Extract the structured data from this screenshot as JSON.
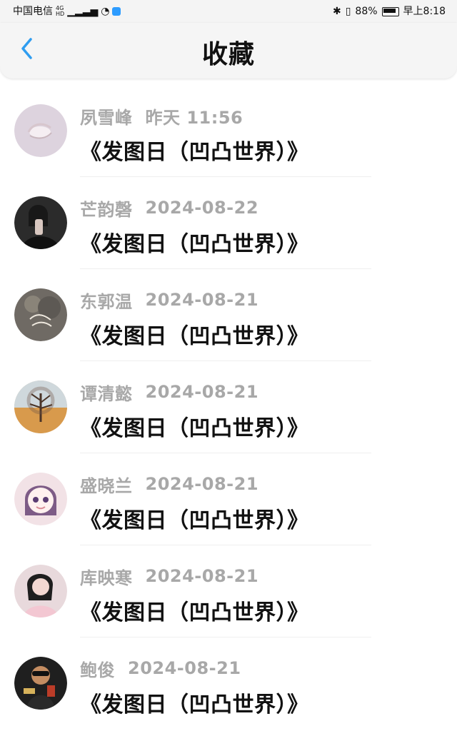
{
  "status_bar": {
    "carrier": "中国电信",
    "network_1": "4G",
    "network_2": "HD",
    "battery": "88%",
    "time": "早上8:18"
  },
  "header": {
    "title": "收藏"
  },
  "favorites": [
    {
      "name": "夙雪峰",
      "time": "昨天 11:56",
      "title": "《发图日（凹凸世界）》",
      "avatar": "avatar-seashell"
    },
    {
      "name": "芒韵磬",
      "time": "2024-08-22",
      "title": "《发图日（凹凸世界）》",
      "avatar": "avatar-selfie"
    },
    {
      "name": "东郭温",
      "time": "2024-08-21",
      "title": "《发图日（凹凸世界）》",
      "avatar": "avatar-hello-august"
    },
    {
      "name": "谭清懿",
      "time": "2024-08-21",
      "title": "《发图日（凹凸世界）》",
      "avatar": "avatar-tree"
    },
    {
      "name": "盛晓兰",
      "time": "2024-08-21",
      "title": "《发图日（凹凸世界）》",
      "avatar": "avatar-anime-girl"
    },
    {
      "name": "库映寒",
      "time": "2024-08-21",
      "title": "《发图日（凹凸世界）》",
      "avatar": "avatar-portrait"
    },
    {
      "name": "鲍俊",
      "time": "2024-08-21",
      "title": "《发图日（凹凸世界）》",
      "avatar": "avatar-man"
    }
  ]
}
